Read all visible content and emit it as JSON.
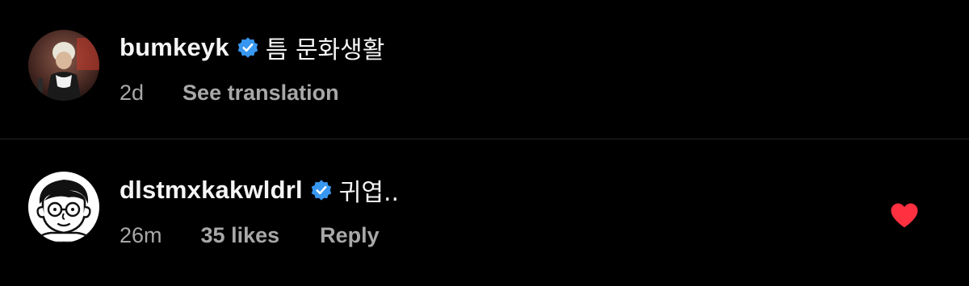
{
  "colors": {
    "background": "#000000",
    "primary_text": "#f5f5f5",
    "secondary_text": "#a8a8a8",
    "verified_badge": "#3897f0",
    "heart": "#ff3040",
    "divider": "#262626"
  },
  "comments": [
    {
      "username": "bumkeyk",
      "verified": true,
      "text": "틈 문화생활",
      "time": "2d",
      "action_label": "See translation"
    },
    {
      "username": "dlstmxkakwldrl",
      "verified": true,
      "text": "귀엽..",
      "time": "26m",
      "likes": "35 likes",
      "action_label": "Reply",
      "liked": true,
      "like_icon": "heart-filled-icon"
    }
  ]
}
